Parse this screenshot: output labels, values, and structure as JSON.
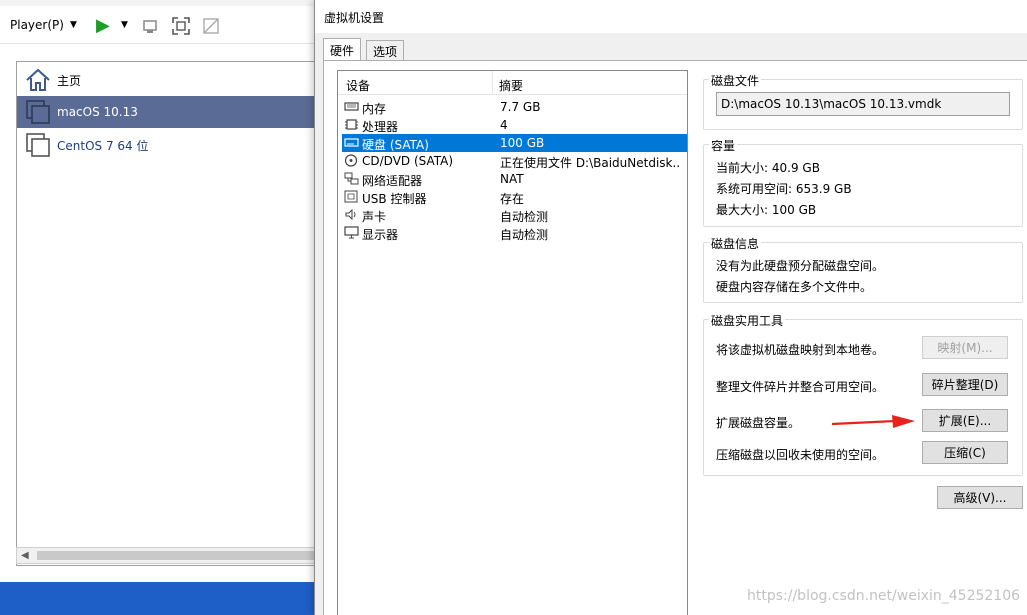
{
  "player": {
    "menu_label": "Player(P)",
    "menu_caret": "▼",
    "library": {
      "items": [
        {
          "label": "主页",
          "icon": "home-icon"
        },
        {
          "label": "macOS 10.13",
          "icon": "vm-icon"
        },
        {
          "label": "CentOS 7 64 位",
          "icon": "vm-icon"
        }
      ]
    }
  },
  "dialog": {
    "title": "虚拟机设置",
    "tabs": [
      "硬件",
      "选项"
    ],
    "device_table": {
      "headers": [
        "设备",
        "摘要"
      ],
      "rows": [
        {
          "name": "内存",
          "summary": "7.7 GB",
          "icon": "memory-icon"
        },
        {
          "name": "处理器",
          "summary": "4",
          "icon": "cpu-icon"
        },
        {
          "name": "硬盘 (SATA)",
          "summary": "100 GB",
          "icon": "harddisk-icon",
          "selected": true
        },
        {
          "name": "CD/DVD (SATA)",
          "summary": "正在使用文件 D:\\BaiduNetdisk...",
          "icon": "cd-icon"
        },
        {
          "name": "网络适配器",
          "summary": "NAT",
          "icon": "network-icon"
        },
        {
          "name": "USB 控制器",
          "summary": "存在",
          "icon": "usb-icon"
        },
        {
          "name": "声卡",
          "summary": "自动检测",
          "icon": "sound-icon"
        },
        {
          "name": "显示器",
          "summary": "自动检测",
          "icon": "display-icon"
        }
      ]
    },
    "disk_file": {
      "title": "磁盘文件",
      "value": "D:\\macOS 10.13\\macOS 10.13.vmdk"
    },
    "capacity": {
      "title": "容量",
      "current_size": "当前大小: 40.9 GB",
      "available_space": "系统可用空间: 653.9 GB",
      "max_size": "最大大小: 100 GB"
    },
    "disk_info": {
      "title": "磁盘信息",
      "line1": "没有为此硬盘预分配磁盘空间。",
      "line2": "硬盘内容存储在多个文件中。"
    },
    "utilities": {
      "title": "磁盘实用工具",
      "map_desc": "将该虚拟机磁盘映射到本地卷。",
      "map_button": "映射(M)...",
      "defrag_desc": "整理文件碎片并整合可用空间。",
      "defrag_button": "碎片整理(D)",
      "expand_desc": "扩展磁盘容量。",
      "expand_button": "扩展(E)...",
      "compact_desc": "压缩磁盘以回收未使用的空间。",
      "compact_button": "压缩(C)"
    },
    "advanced_button": "高级(V)..."
  },
  "colors": {
    "selection": "#0078d7",
    "library_selection": "#5a6c95",
    "annotation_arrow": "#e8231c",
    "taskbar": "#1d5fc7"
  },
  "watermark": "https://blog.csdn.net/weixin_45252106"
}
